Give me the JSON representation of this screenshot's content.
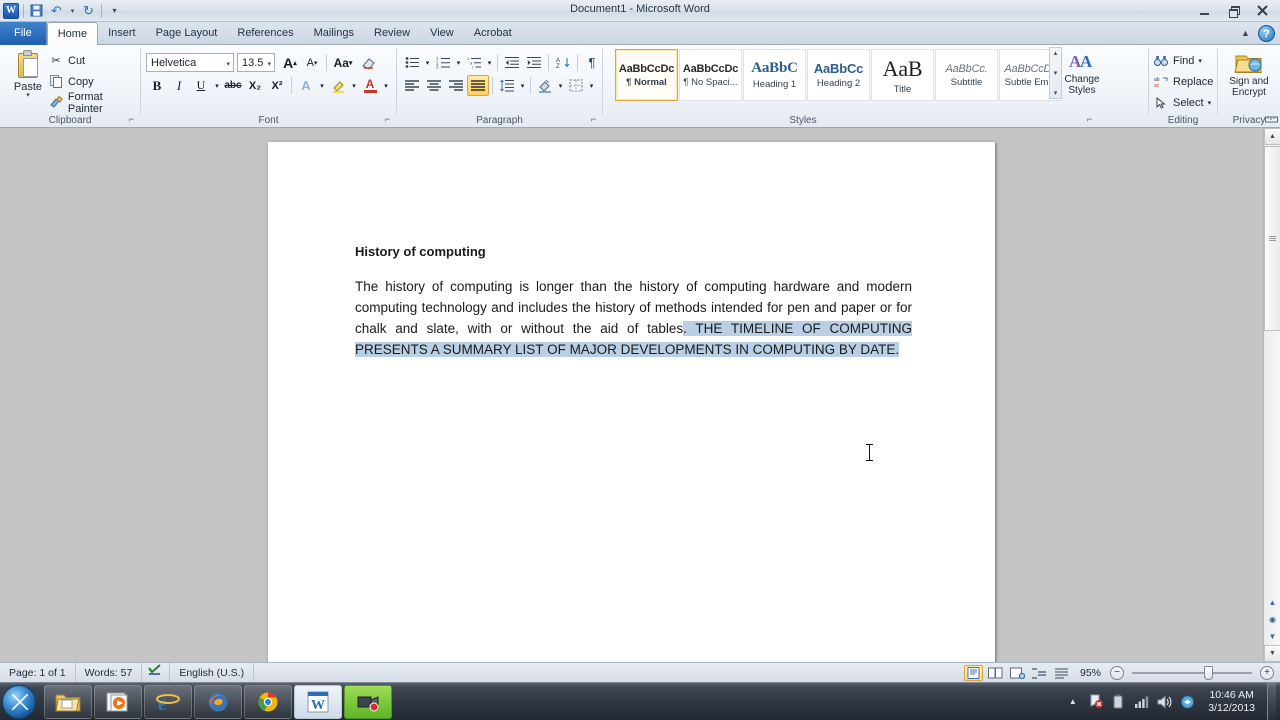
{
  "window": {
    "title": "Document1 - Microsoft Word",
    "app_icon": "W",
    "quick_access": [
      {
        "name": "save-icon",
        "glyph": "⬓"
      },
      {
        "name": "undo-icon",
        "glyph": "↶"
      },
      {
        "name": "redo-icon",
        "glyph": "↻"
      },
      {
        "name": "customize-qat-icon",
        "glyph": "▾"
      }
    ],
    "controls": [
      {
        "name": "minimize-button",
        "label": "Minimize"
      },
      {
        "name": "restore-button",
        "label": "Restore Down"
      },
      {
        "name": "close-button",
        "label": "Close",
        "glyph": "✕"
      }
    ],
    "help_glyph": "?",
    "collapse_ribbon_glyph": "▲"
  },
  "tabs": [
    {
      "label": "File",
      "active": false,
      "file": true
    },
    {
      "label": "Home",
      "active": true
    },
    {
      "label": "Insert",
      "active": false
    },
    {
      "label": "Page Layout",
      "active": false
    },
    {
      "label": "References",
      "active": false
    },
    {
      "label": "Mailings",
      "active": false
    },
    {
      "label": "Review",
      "active": false
    },
    {
      "label": "View",
      "active": false
    },
    {
      "label": "Acrobat",
      "active": false
    }
  ],
  "ribbon": {
    "clipboard": {
      "group_label": "Clipboard",
      "paste_label": "Paste",
      "cut_label": "Cut",
      "copy_label": "Copy",
      "format_painter_label": "Format Painter",
      "cut_icon": "✂",
      "copy_icon": "⧉",
      "format_painter_icon": "✎"
    },
    "font": {
      "group_label": "Font",
      "font_name": "Helvetica",
      "font_size": "13.5",
      "grow_font": "A",
      "shrink_font": "A",
      "change_case": "Aa",
      "clear_formatting": "✐",
      "bold": "B",
      "italic": "I",
      "underline": "U",
      "strikethrough": "abc",
      "subscript": "X₂",
      "superscript": "X²",
      "text_effects": "A",
      "highlight": "ab",
      "font_color": "A"
    },
    "paragraph": {
      "group_label": "Paragraph",
      "bullets": "☰",
      "numbering": "☷",
      "multilevel": "≡",
      "decrease_indent": "⇤",
      "increase_indent": "⇥",
      "sort": "A↓",
      "show_marks": "¶",
      "align_left": "≡",
      "align_center": "≡",
      "align_right": "≡",
      "justify": "≡",
      "justify_active": true,
      "line_spacing": "↕",
      "shading": "▤",
      "borders": "▦"
    },
    "styles": {
      "group_label": "Styles",
      "items": [
        {
          "preview": "AaBbCcDc",
          "name": "¶ Normal",
          "selected": true
        },
        {
          "preview": "AaBbCcDc",
          "name": "¶ No Spaci...",
          "selected": false
        },
        {
          "preview": "AaBbC",
          "name": "Heading 1",
          "selected": false
        },
        {
          "preview": "AaBbCc",
          "name": "Heading 2",
          "selected": false
        },
        {
          "preview": "AaB",
          "name": "Title",
          "selected": false
        },
        {
          "preview": "AaBbCc.",
          "name": "Subtitle",
          "selected": false
        },
        {
          "preview": "AaBbCcDc",
          "name": "Subtle Em...",
          "selected": false
        }
      ],
      "scroll_up": "▴",
      "scroll_down": "▾",
      "more": "▾"
    },
    "change_styles": {
      "label_line1": "Change",
      "label_line2": "Styles",
      "icon": "AA"
    },
    "editing": {
      "group_label": "Editing",
      "find_label": "Find",
      "replace_label": "Replace",
      "select_label": "Select",
      "find_icon": "⚲",
      "replace_icon": "ab",
      "select_icon": "↖"
    },
    "privacy": {
      "group_label": "Privacy",
      "label_line1": "Sign and",
      "label_line2": "Encrypt"
    }
  },
  "document": {
    "heading": "History of computing",
    "paragraph_plain": "The history of computing is longer than the history of computing hardware and modern computing technology and includes the history of methods intended for pen and paper or for chalk and slate, with or without the aid of tables",
    "paragraph_selected": ". THE TIMELINE OF COMPUTING PRESENTS A SUMMARY LIST OF MAJOR DEVELOPMENTS IN COMPUTING BY DATE."
  },
  "status_bar": {
    "page": "Page: 1 of 1",
    "words": "Words: 57",
    "proofing_icon": "✓",
    "language": "English (U.S.)",
    "zoom": "95%",
    "view_buttons": [
      {
        "name": "print-layout-view",
        "glyph": "▤",
        "active": true
      },
      {
        "name": "full-screen-reading-view",
        "glyph": "▧",
        "active": false
      },
      {
        "name": "web-layout-view",
        "glyph": "▦",
        "active": false
      },
      {
        "name": "outline-view",
        "glyph": "≣",
        "active": false
      },
      {
        "name": "draft-view",
        "glyph": "≡",
        "active": false
      }
    ],
    "zoom_out": "−",
    "zoom_in": "+"
  },
  "taskbar": {
    "start_label": "Start",
    "items": [
      {
        "name": "taskbar-file-explorer",
        "label": "Windows Explorer",
        "active": false
      },
      {
        "name": "taskbar-media-player",
        "label": "Windows Media Player",
        "active": false
      },
      {
        "name": "taskbar-internet-explorer",
        "label": "Internet Explorer",
        "active": false
      },
      {
        "name": "taskbar-firefox",
        "label": "Mozilla Firefox",
        "active": false
      },
      {
        "name": "taskbar-chrome",
        "label": "Google Chrome",
        "active": false
      },
      {
        "name": "taskbar-word",
        "label": "Microsoft Word",
        "active": true
      },
      {
        "name": "taskbar-recorder",
        "label": "Screen Recorder",
        "highlighted": true
      }
    ],
    "tray": [
      {
        "name": "show-hidden-icons",
        "glyph": "▲"
      },
      {
        "name": "action-center-icon",
        "glyph": "⚑"
      },
      {
        "name": "battery-icon",
        "glyph": "▯"
      },
      {
        "name": "network-icon",
        "glyph": "▰"
      },
      {
        "name": "volume-icon",
        "glyph": "ὐA"
      },
      {
        "name": "dropbox-icon",
        "glyph": "◆"
      }
    ],
    "time": "10:46 AM",
    "date": "3/12/2013"
  },
  "colors": {
    "accent_blue": "#1f5fae",
    "selection": "#b8cfe5",
    "canvas_gray": "#c4c4c4",
    "highlight_gold": "#ffcf5c"
  }
}
